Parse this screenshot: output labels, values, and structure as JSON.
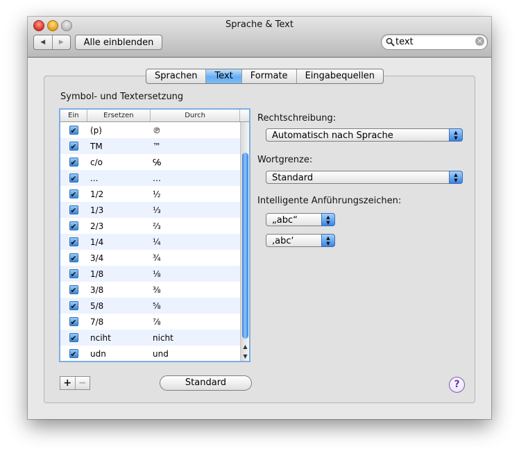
{
  "window": {
    "title": "Sprache & Text"
  },
  "toolbar": {
    "back_icon": "left-arrow-icon",
    "forward_icon": "right-arrow-icon",
    "show_all_label": "Alle einblenden",
    "search": {
      "value": "text",
      "icon": "search-icon"
    }
  },
  "tabs": [
    {
      "label": "Sprachen",
      "active": false
    },
    {
      "label": "Text",
      "active": true
    },
    {
      "label": "Formate",
      "active": false
    },
    {
      "label": "Eingabequellen",
      "active": false
    }
  ],
  "substitution": {
    "title": "Symbol- und Textersetzung",
    "columns": [
      "Ein",
      "Ersetzen",
      "Durch"
    ],
    "rows": [
      {
        "enabled": true,
        "replace": "(p)",
        "with": "℗"
      },
      {
        "enabled": true,
        "replace": "TM",
        "with": "™"
      },
      {
        "enabled": true,
        "replace": "c/o",
        "with": "℅"
      },
      {
        "enabled": true,
        "replace": "...",
        "with": "…"
      },
      {
        "enabled": true,
        "replace": "1/2",
        "with": "½"
      },
      {
        "enabled": true,
        "replace": "1/3",
        "with": "⅓"
      },
      {
        "enabled": true,
        "replace": "2/3",
        "with": "⅔"
      },
      {
        "enabled": true,
        "replace": "1/4",
        "with": "¼"
      },
      {
        "enabled": true,
        "replace": "3/4",
        "with": "¾"
      },
      {
        "enabled": true,
        "replace": "1/8",
        "with": "⅛"
      },
      {
        "enabled": true,
        "replace": "3/8",
        "with": "⅜"
      },
      {
        "enabled": true,
        "replace": "5/8",
        "with": "⅝"
      },
      {
        "enabled": true,
        "replace": "7/8",
        "with": "⅞"
      },
      {
        "enabled": true,
        "replace": "nciht",
        "with": "nicht"
      },
      {
        "enabled": true,
        "replace": "udn",
        "with": "und"
      }
    ],
    "add_label": "+",
    "remove_label": "−",
    "standard_button": "Standard"
  },
  "spelling": {
    "label": "Rechtschreibung:",
    "value": "Automatisch nach Sprache"
  },
  "word_break": {
    "label": "Wortgrenze:",
    "value": "Standard"
  },
  "smart_quotes": {
    "label": "Intelligente Anführungszeichen:",
    "double": "„abc“",
    "single": "‚abc‘"
  },
  "help_label": "?"
}
